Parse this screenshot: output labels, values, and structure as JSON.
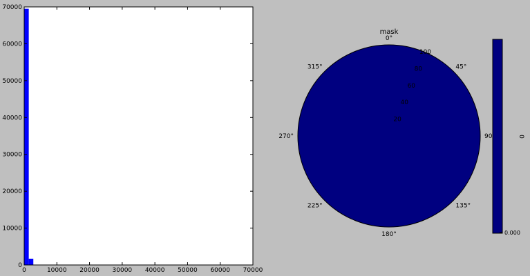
{
  "figure_bg": "#bfbfbf",
  "chart_data": [
    {
      "type": "bar",
      "title": "",
      "xlabel": "",
      "ylabel": "",
      "xlim": [
        0,
        70000
      ],
      "ylim": [
        0,
        70000
      ],
      "bar_color": "#0000ff",
      "x_ticks": [
        0,
        10000,
        20000,
        30000,
        40000,
        50000,
        60000,
        70000
      ],
      "y_ticks": [
        0,
        10000,
        20000,
        30000,
        40000,
        50000,
        60000,
        70000
      ],
      "bins": [
        {
          "x0": 0,
          "x1": 1400,
          "value": 69500
        },
        {
          "x0": 1400,
          "x1": 2800,
          "value": 1700
        }
      ]
    },
    {
      "type": "heatmap",
      "projection": "polar",
      "title": "mask",
      "fill_color": "#000080",
      "angle_labels": [
        "0°",
        "45°",
        "90°",
        "135°",
        "180°",
        "225°",
        "270°",
        "315°"
      ],
      "radial_labels": [
        "20",
        "40",
        "60",
        "80",
        "100"
      ],
      "colorbar": {
        "label": "0",
        "tick_label": "0.000"
      }
    }
  ]
}
